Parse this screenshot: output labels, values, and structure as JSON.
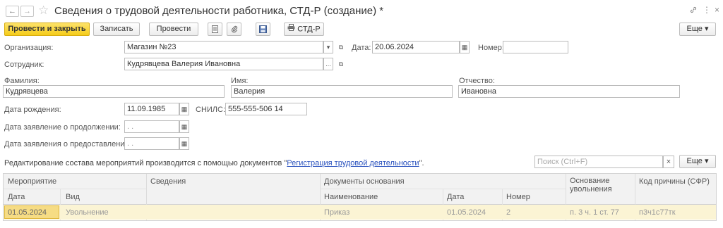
{
  "window": {
    "back": "←",
    "forward": "→",
    "star": "☆",
    "title": "Сведения о трудовой деятельности работника, СТД-Р (создание) *",
    "link_icon": "link-icon",
    "more_icon": "⋮",
    "close_icon": "×"
  },
  "toolbar": {
    "post_close": "Провести и закрыть",
    "save": "Записать",
    "post": "Провести",
    "print": "СТД-Р",
    "more": "Еще ▾"
  },
  "form": {
    "organization_label": "Организация:",
    "organization_value": "Магазин №23",
    "date_label": "Дата:",
    "date_value": "20.06.2024",
    "number_label": "Номер:",
    "number_value": "",
    "employee_label": "Сотрудник:",
    "employee_value": "Кудрявцева Валерия Ивановна",
    "lastname_label": "Фамилия:",
    "lastname_value": "Кудрявцева",
    "firstname_label": "Имя:",
    "firstname_value": "Валерия",
    "patronymic_label": "Отчество:",
    "patronymic_value": "Ивановна",
    "birthdate_label": "Дата рождения:",
    "birthdate_value": "11.09.1985",
    "snils_label": "СНИЛС:",
    "snils_value": "555-555-506 14",
    "continue_label": "Дата заявление о продолжении:",
    "continue_value": "  .  .",
    "provide_label": "Дата заявления о предоставлении:",
    "provide_value": "  .  .",
    "dropdown_glyph": "▾",
    "open_glyph": "⧉",
    "ellipsis_glyph": "...",
    "calendar_glyph": "▦"
  },
  "info": {
    "text_before": "Редактирование состава мероприятий производится с помощью документов \"",
    "link": "Регистрация трудовой деятельности",
    "text_after": "\".",
    "search_placeholder": "Поиск (Ctrl+F)",
    "clear": "×",
    "more": "Еще ▾"
  },
  "table": {
    "group_headers": {
      "event": "Мероприятие",
      "details": "Сведения",
      "docs": "Документы основания",
      "reason": "Основание увольнения",
      "code": "Код причины (СФР)"
    },
    "sub_headers": {
      "date": "Дата",
      "kind": "Вид",
      "doc_name": "Наименование",
      "doc_date": "Дата",
      "doc_number": "Номер"
    },
    "rows": [
      {
        "date": "01.05.2024",
        "kind": "Увольнение",
        "details": "",
        "doc_name": "Приказ",
        "doc_date": "01.05.2024",
        "doc_number": "2",
        "reason": "п. 3 ч. 1 ст. 77",
        "code": "п3ч1с77тк"
      }
    ]
  },
  "colors": {
    "accent": "#f5cc1a",
    "row_highlight": "#fbf4d4",
    "cell_selected": "#f6dc84",
    "link": "#2a52be",
    "header_bg": "#f2f2f2"
  }
}
